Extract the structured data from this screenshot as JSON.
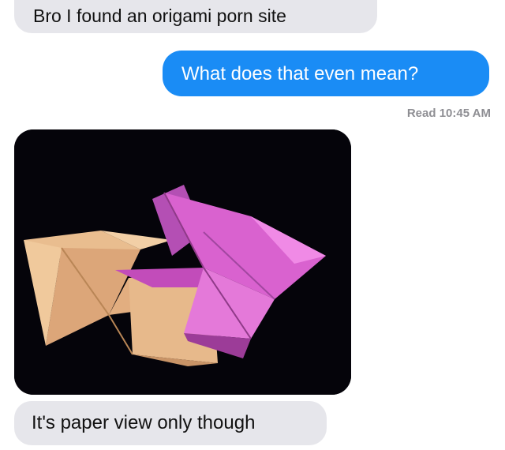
{
  "conversation": {
    "messages": [
      {
        "sender": "them",
        "text": "Bro I found an origami porn site"
      },
      {
        "sender": "me",
        "text": "What does that even mean?"
      },
      {
        "sender": "them",
        "text": "It's paper view only though"
      }
    ],
    "read_receipt": "Read 10:45 AM",
    "photo": {
      "subject": "origami-stars-photo"
    }
  },
  "colors": {
    "sent_bubble": "#1a8cf5",
    "received_bubble": "#e6e6eb",
    "read_receipt": "#8e8e93",
    "photo_background": "#05040a",
    "origami_tan": "#e8b888",
    "origami_pink": "#d05ac8"
  }
}
